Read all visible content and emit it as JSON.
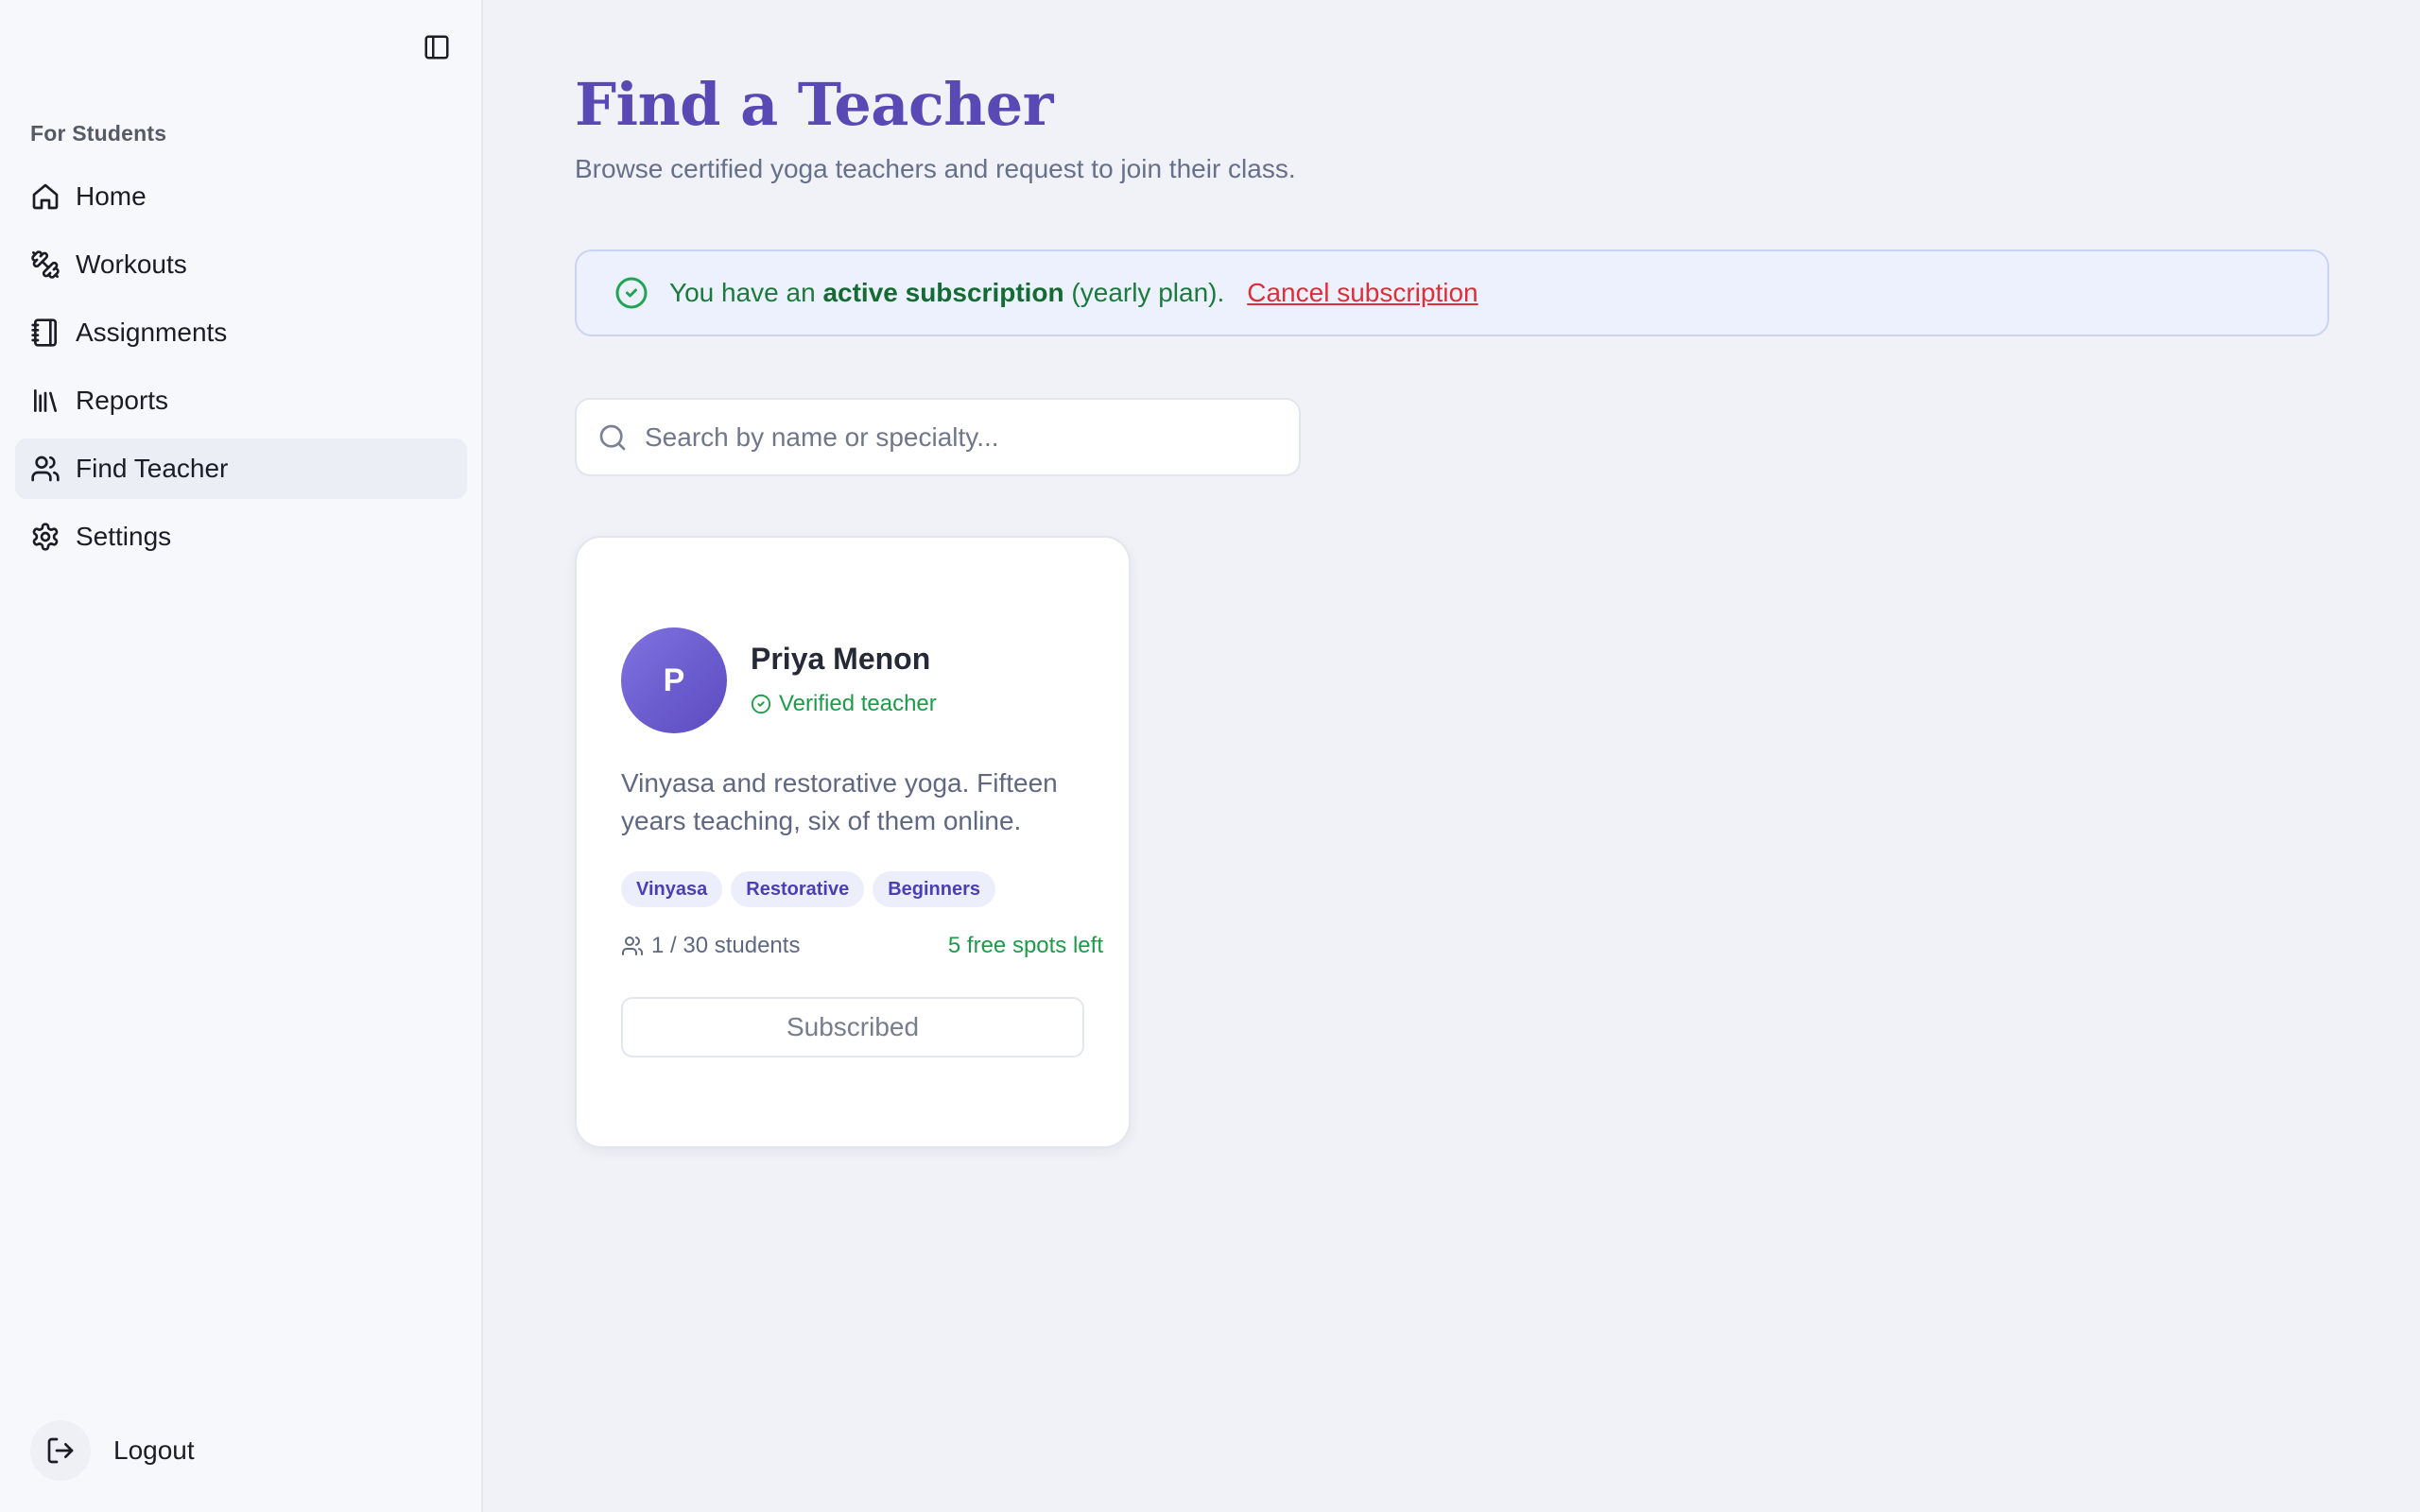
{
  "sidebar": {
    "section_label": "For Students",
    "items": [
      {
        "label": "Home",
        "icon": "home-icon",
        "active": false
      },
      {
        "label": "Workouts",
        "icon": "dumbbell-icon",
        "active": false
      },
      {
        "label": "Assignments",
        "icon": "notebook-icon",
        "active": false
      },
      {
        "label": "Reports",
        "icon": "library-icon",
        "active": false
      },
      {
        "label": "Find Teacher",
        "icon": "users-icon",
        "active": true
      },
      {
        "label": "Settings",
        "icon": "gear-icon",
        "active": false
      }
    ],
    "logout_label": "Logout"
  },
  "page": {
    "title": "Find a Teacher",
    "subtitle": "Browse certified yoga teachers and request to join their class."
  },
  "banner": {
    "text_before": "You have an",
    "text_bold": "active subscription",
    "text_after": "(yearly plan).",
    "cancel_label": "Cancel subscription"
  },
  "search": {
    "placeholder": "Search by name or specialty...",
    "value": ""
  },
  "teachers": [
    {
      "initial": "P",
      "name": "Priya Menon",
      "verified_label": "Verified teacher",
      "bio": "Vinyasa and restorative yoga. Fifteen years teaching, six of them online.",
      "tags": [
        "Vinyasa",
        "Restorative",
        "Beginners"
      ],
      "students": "1 / 30 students",
      "spots": "5 free spots left",
      "button_label": "Subscribed"
    }
  ],
  "colors": {
    "accent": "#5a48b5",
    "success": "#1e9a4a",
    "danger": "#dc2f3a"
  }
}
